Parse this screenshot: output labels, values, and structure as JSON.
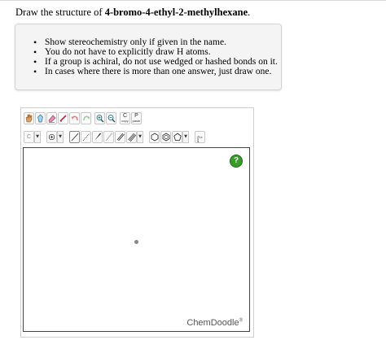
{
  "question": {
    "prefix": "Draw the structure of ",
    "compound": "4-bromo-4-ethyl-2-methylhexane",
    "suffix": "."
  },
  "instructions": [
    "Show stereochemistry only if given in the name.",
    "You do not have to explicitly draw H atoms.",
    "If a group is achiral, do not use wedged or hashed bonds on it.",
    "In cases where there is more than one answer, just draw one."
  ],
  "toolbar": {
    "copy_label": "C",
    "copy_sub": "copy",
    "paste_label": "P",
    "paste_sub": "paste",
    "element_label": "C",
    "bracket_label": "[",
    "bracket_sup": "1±"
  },
  "canvas": {
    "help_label": "?",
    "brand": "ChemDoodle",
    "brand_mark": "®"
  },
  "colors": {
    "help_green": "#3a9a2c",
    "panel_bg": "#f4f4f4"
  }
}
